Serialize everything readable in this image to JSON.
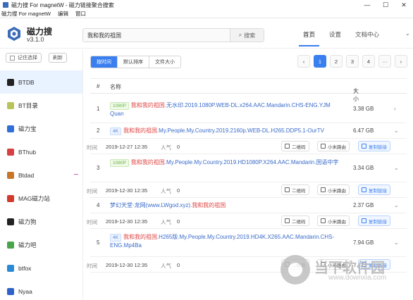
{
  "window": {
    "title": "磁力搜 For magnetW - 磁力链接聚合搜索",
    "min_glyph": "—",
    "max_glyph": "☐",
    "close_glyph": "✕"
  },
  "menu": [
    "磁力搜 For magnetW",
    "编辑",
    "窗口"
  ],
  "header": {
    "brand": "磁力搜",
    "version": "v3.1.0",
    "search_value": "我和我的祖国",
    "search_button": "搜索",
    "nav": [
      "首页",
      "设置",
      "文档中心"
    ]
  },
  "sidebar": {
    "remember_label": "记住选择",
    "refresh_label": "刷新",
    "items": [
      {
        "label": "BTDB",
        "icon": "btdb-icon",
        "color": "#222222"
      },
      {
        "label": "BT目录",
        "icon": "bt-catalog-icon",
        "color": "#b9c35a"
      },
      {
        "label": "磁力宝",
        "icon": "cilibao-icon",
        "color": "#2f6fd6"
      },
      {
        "label": "BThub",
        "icon": "bthub-icon",
        "color": "#d64040"
      },
      {
        "label": "Btdad",
        "icon": "btdad-icon",
        "color": "#c9762d"
      },
      {
        "label": "MAG磁力站",
        "icon": "mag-magnet-icon",
        "color": "#d33a2c"
      },
      {
        "label": "磁力狗",
        "icon": "cilidog-icon",
        "color": "#222222"
      },
      {
        "label": "磁力吧",
        "icon": "ciliba-icon",
        "color": "#4aa44a"
      },
      {
        "label": "btfox",
        "icon": "btfox-icon",
        "color": "#2b8ad6"
      },
      {
        "label": "Nyaa",
        "icon": "nyaa-icon",
        "color": "#2f63c8"
      }
    ]
  },
  "sort_tabs": [
    "按时间",
    "默认排序",
    "文件大小"
  ],
  "pager": {
    "pages": [
      "1",
      "2",
      "3",
      "4",
      "···"
    ],
    "prev": "‹",
    "next": "›"
  },
  "table": {
    "col_index": "#",
    "col_name": "名称",
    "col_size": "大小",
    "time_label": "时间",
    "hot_label": "人气",
    "qr_label": "二维码",
    "mi_label": "小米路由",
    "copy_label": "复制链接",
    "rows": [
      {
        "idx": "1",
        "badge": "1080P",
        "hl": "我和我的祖国",
        "rest": ".无水印.2019.1080P.WEB-DL.x264.AAC.Mandarin.CHS-ENG.YJM Quan",
        "size": "3.38 GB"
      },
      {
        "idx": "2",
        "badge": "4K",
        "hl": "我和我的祖国",
        "rest": ".My.People.My.Country.2019.2160p.WEB-DL.H265.DDP5.1-OurTV",
        "size": "6.47 GB",
        "time": "2019-12-27 12:35",
        "hot": "0"
      },
      {
        "idx": "3",
        "badge": "1080P",
        "hl": "我和我的祖国",
        "rest": ".My.People.My.Country.2019.HD1080P.X264.AAC.Mandarin.国语中字",
        "size": "3.34 GB",
        "time": "2019-12-30 12:35",
        "hot": "0"
      },
      {
        "idx": "4",
        "badge": "",
        "pre": "梦幻天堂·龙网(www.LWgod.xyz).",
        "hl": "我和我的祖国",
        "rest": "",
        "size": "2.37 GB",
        "time": "2019-12-30 12:35",
        "hot": "0"
      },
      {
        "idx": "5",
        "badge": "4K",
        "hl": "我和我的祖国",
        "rest": ".H265版.My.People.My.Country.2019.HD4K.X265.AAC.Mandarin.CHS-ENG.Mp4Ba",
        "size": "7.94 GB",
        "time": "2019-12-30 12:35",
        "hot": "0"
      }
    ]
  },
  "watermark": {
    "text": "当下软件园",
    "url": "www.downxia.com"
  }
}
